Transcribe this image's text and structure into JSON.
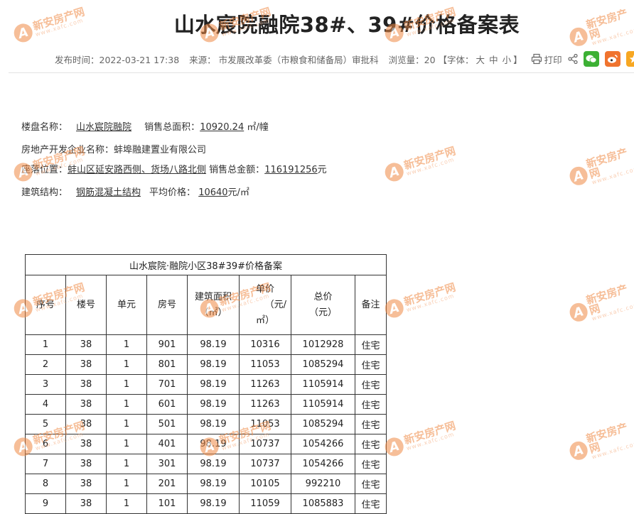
{
  "title": "山水宸院融院38#、39#价格备案表",
  "meta": {
    "publish": "发布时间：2022-03-21 17:38",
    "source": "来源：  市发展改革委（市粮食和储备局）审批科",
    "views": "浏览量：20",
    "font_prefix": "【字体：",
    "font_large": "大",
    "font_medium": "中",
    "font_small": "小",
    "font_suffix": "】",
    "print": "打印"
  },
  "share_icons": [
    "share-icon",
    "wechat-icon",
    "weibo-icon",
    "favorite-icon"
  ],
  "colors": {
    "wechat": "#3cb034",
    "weibo": "#f0742f",
    "favorite": "#f7a722",
    "watermark": "#f08a45"
  },
  "info": {
    "name_label": "楼盘名称：",
    "name_value": "山水宸院融院",
    "area_label": "销售总面积：",
    "area_value": "10920.24",
    "area_unit": "㎡/幢",
    "dev_label": "房地产开发企业名称：",
    "dev_value": "蚌埠融建置业有限公司",
    "loc_label": "座落位置：",
    "loc_value": "蚌山区延安路西侧、货场八路北侧",
    "total_label": "销售总金额：",
    "total_value": "116191256",
    "total_unit": "元",
    "struct_label": "建筑结构：",
    "struct_value": "钢筋混凝土结构",
    "avg_label": "平均价格：",
    "avg_value": "10640",
    "avg_unit": "元/㎡"
  },
  "table": {
    "caption": "山水宸院·融院小区38#39#价格备案",
    "headers": {
      "room_no": "序号",
      "building": "楼号",
      "unit": "单元",
      "room": "房号",
      "area_line1": "建筑面积",
      "area_line2": "（㎡）",
      "price_line1": "单价",
      "price_line2": "（元/",
      "price_line3": "㎡）",
      "total_line1": "总价",
      "total_line2": "（元）",
      "note": "备注"
    },
    "rows": [
      [
        "1",
        "38",
        "1",
        "901",
        "98.19",
        "10316",
        "1012928",
        "住宅"
      ],
      [
        "2",
        "38",
        "1",
        "801",
        "98.19",
        "11053",
        "1085294",
        "住宅"
      ],
      [
        "3",
        "38",
        "1",
        "701",
        "98.19",
        "11263",
        "1105914",
        "住宅"
      ],
      [
        "4",
        "38",
        "1",
        "601",
        "98.19",
        "11263",
        "1105914",
        "住宅"
      ],
      [
        "5",
        "38",
        "1",
        "501",
        "98.19",
        "11053",
        "1085294",
        "住宅"
      ],
      [
        "6",
        "38",
        "1",
        "401",
        "98.19",
        "10737",
        "1054266",
        "住宅"
      ],
      [
        "7",
        "38",
        "1",
        "301",
        "98.19",
        "10737",
        "1054266",
        "住宅"
      ],
      [
        "8",
        "38",
        "1",
        "201",
        "98.19",
        "10105",
        "992210",
        "住宅"
      ],
      [
        "9",
        "38",
        "1",
        "101",
        "98.19",
        "11059",
        "1085883",
        "住宅"
      ]
    ]
  },
  "watermark": {
    "name": "新安房产网",
    "domain": "www.xafc.com",
    "logo_letter": "A"
  }
}
